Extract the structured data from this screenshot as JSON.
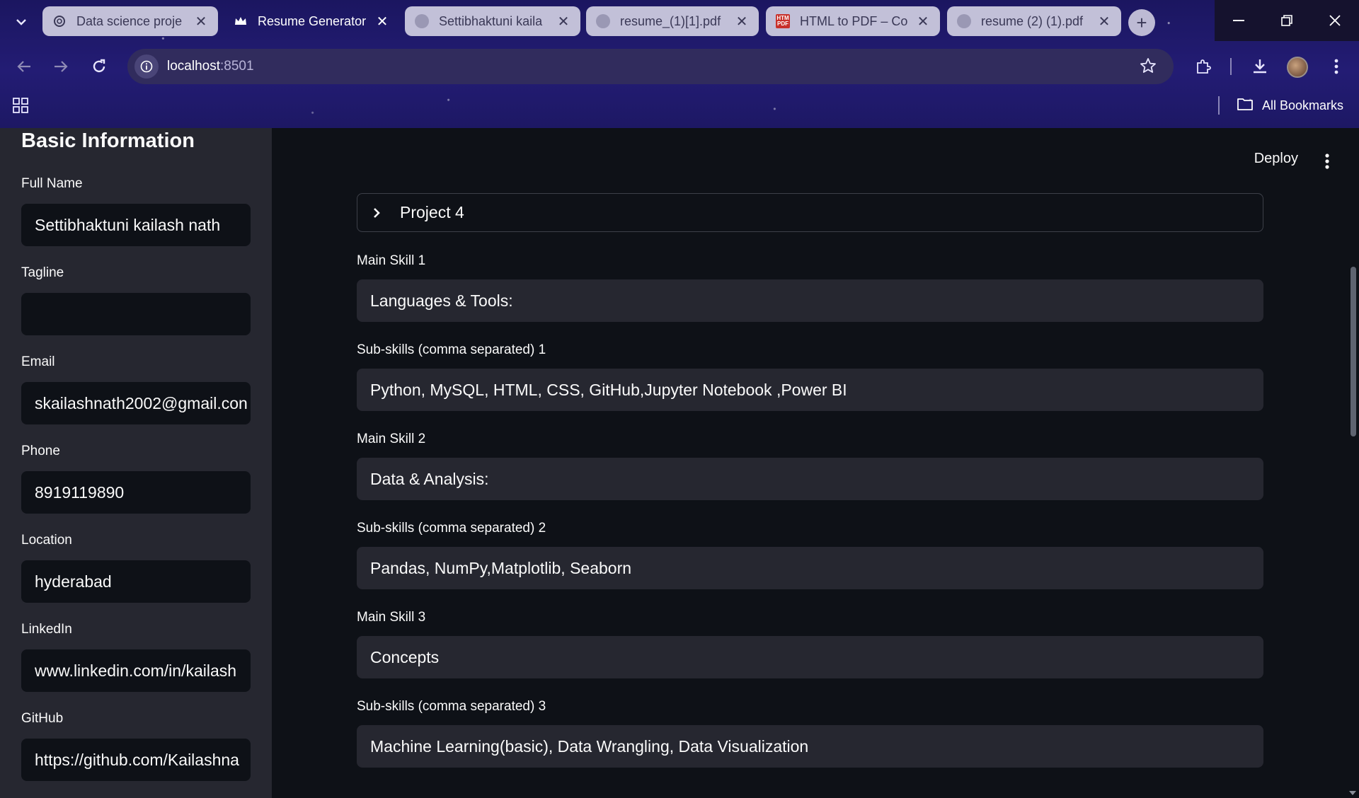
{
  "browser": {
    "tabs": [
      {
        "title": "Data science proje",
        "icon": "openai-icon",
        "active": false
      },
      {
        "title": "Resume Generator",
        "icon": "streamlit-crown-icon",
        "active": true
      },
      {
        "title": "Settibhaktuni kaila",
        "icon": "globe-icon",
        "active": false
      },
      {
        "title": "resume_(1)[1].pdf",
        "icon": "globe-icon",
        "active": false
      },
      {
        "title": "HTML to PDF – Co",
        "icon": "htm-pdf-icon",
        "active": false
      },
      {
        "title": "resume (2) (1).pdf",
        "icon": "globe-icon",
        "active": false
      }
    ],
    "url_host": "localhost",
    "url_port": ":8501",
    "bookmarks_label": "All Bookmarks"
  },
  "sidebar": {
    "heading": "Basic Information",
    "fields": [
      {
        "label": "Full Name",
        "value": "Settibhaktuni kailash nath"
      },
      {
        "label": "Tagline",
        "value": ""
      },
      {
        "label": "Email",
        "value": "skailashnath2002@gmail.con"
      },
      {
        "label": "Phone",
        "value": "8919119890"
      },
      {
        "label": "Location",
        "value": "hyderabad"
      },
      {
        "label": "LinkedIn",
        "value": "www.linkedin.com/in/kailash"
      },
      {
        "label": "GitHub",
        "value": "https://github.com/Kailashna"
      }
    ]
  },
  "main": {
    "deploy_label": "Deploy",
    "expander_label": "Project 4",
    "fields": [
      {
        "label": "Main Skill 1",
        "value": "Languages & Tools:"
      },
      {
        "label": "Sub-skills (comma separated) 1",
        "value": "Python, MySQL, HTML, CSS, GitHub,Jupyter Notebook ,Power BI"
      },
      {
        "label": "Main Skill 2",
        "value": "Data & Analysis:"
      },
      {
        "label": "Sub-skills (comma separated) 2",
        "value": "Pandas, NumPy,Matplotlib, Seaborn"
      },
      {
        "label": "Main Skill 3",
        "value": "Concepts"
      },
      {
        "label": "Sub-skills (comma separated) 3",
        "value": "Machine Learning(basic), Data Wrangling, Data Visualization"
      }
    ]
  },
  "colors": {
    "chrome_bg": "#1f1a6b",
    "sidebar_bg": "#262730",
    "main_bg": "#0e1117",
    "input_bg_main": "#262730",
    "input_bg_sidebar": "#0e1117",
    "text": "#fafafa"
  }
}
